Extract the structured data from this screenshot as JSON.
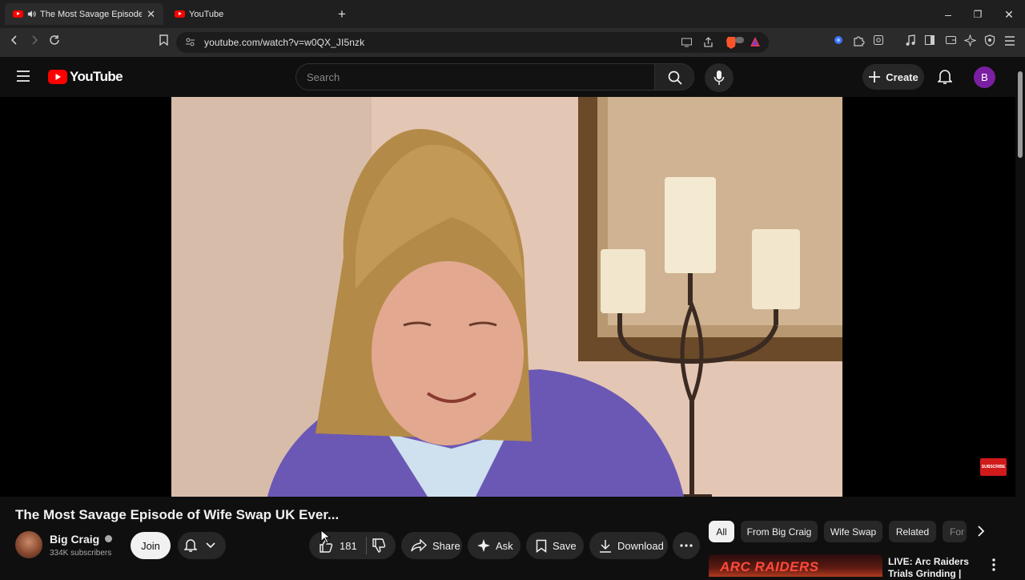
{
  "browser": {
    "tabs": [
      {
        "title": "The Most Savage Episode of Wife Swap UK Ever...",
        "active": true,
        "audio": true
      },
      {
        "title": "YouTube",
        "active": false
      }
    ],
    "url": "youtube.com/watch?v=w0QX_JI5nzk"
  },
  "youtube": {
    "logo_text": "YouTube",
    "search_placeholder": "Search",
    "create_label": "Create",
    "avatar_letter": "B"
  },
  "video": {
    "title": "The Most Savage Episode of Wife Swap UK Ever...",
    "watermark": "SUBSCRIBE",
    "channel": {
      "name": "Big Craig",
      "subscribers": "334K subscribers",
      "verified": true
    },
    "join_label": "Join",
    "like_count": "181",
    "share_label": "Share",
    "ask_label": "Ask",
    "save_label": "Save",
    "download_label": "Download"
  },
  "chips": [
    "All",
    "From Big Craig",
    "Wife Swap",
    "Related",
    "For You"
  ],
  "recommendation": {
    "title": "LIVE: Arc Raiders Trials Grinding |",
    "thumb_text": "ARC RAIDERS"
  },
  "colors": {
    "accent": "#ff0000",
    "bg": "#0f0f0f",
    "chip": "#272727",
    "avatar": "#7b1fa2"
  }
}
